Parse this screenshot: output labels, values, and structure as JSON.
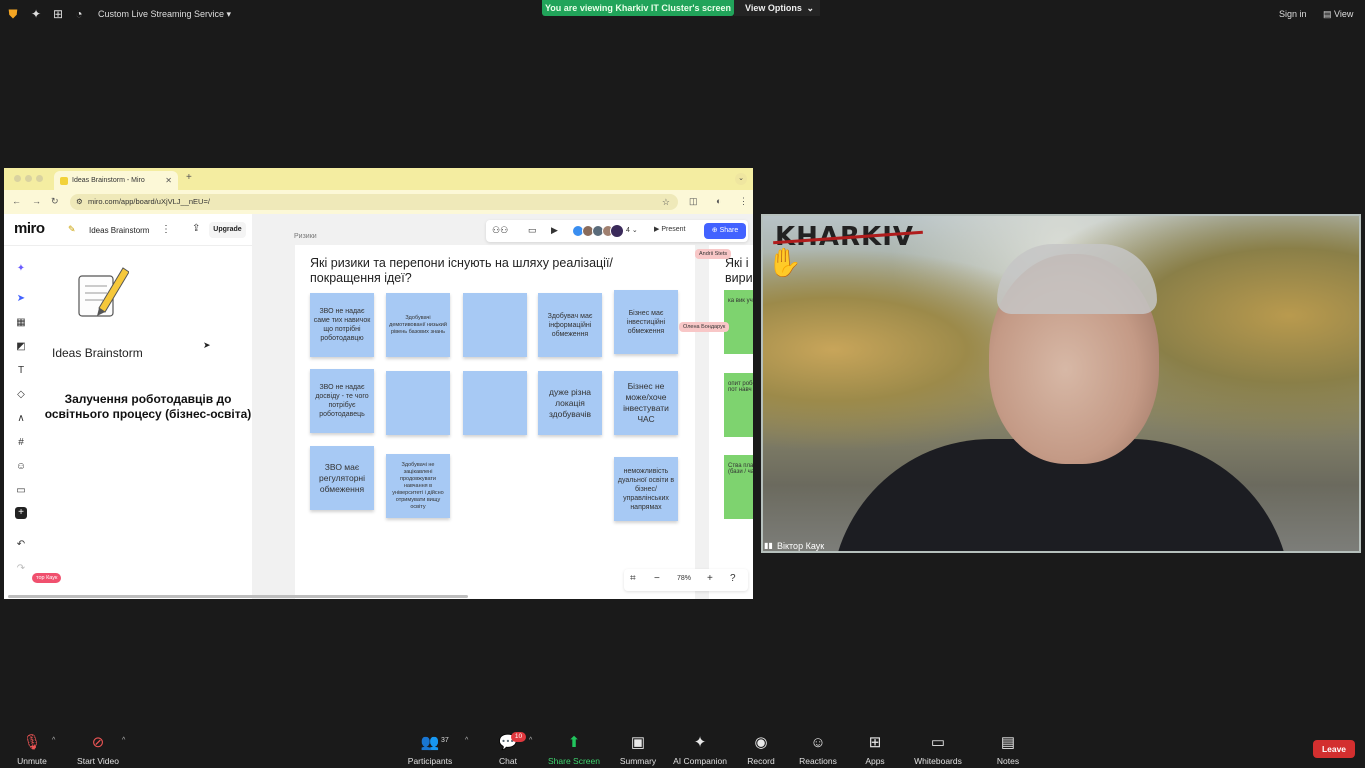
{
  "topbar": {
    "stream_label": "Custom Live Streaming Service ▾",
    "viewing_banner": "You are viewing Kharkiv IT Cluster's screen",
    "view_options": "View Options",
    "sign_in": "Sign in",
    "view": "View"
  },
  "browser": {
    "tab_title": "Ideas Brainstorm - Miro",
    "url": "miro.com/app/board/uXjVLJ__nEU=/"
  },
  "miro": {
    "logo": "miro",
    "board_name": "Ideas Brainstorm",
    "upgrade": "Upgrade",
    "present": "Present",
    "share": "Share",
    "avatar_count": "4",
    "zoom": "78%",
    "panel": {
      "ideas_title": "Ideas Brainstorm",
      "main_title": "Залучення роботодавців до освітнього процесу (бізнес-освіта)"
    },
    "cursor_tag": "тор Каук",
    "frame_label": "Ризики",
    "frame_title": "Які ризики та перепони існують на шляху реалізації/ покращення ідеї?",
    "frame2_title": "Які і вири",
    "collaborators": [
      "Andrii Stets",
      "Олена Бондарук"
    ],
    "stickies": [
      "ЗВО не надає саме тих навичок що потрібні роботодавцю",
      "Здобувачі демотивовані/ низький рівень базових знань",
      "",
      "Здобувач має інформаційні обмеження",
      "Бізнес має інвестиційні обмеження",
      "ЗВО не надає досвіду - те чого потрібує роботодавець",
      "",
      "",
      "дуже різна локація здобувачів",
      "Бізнес не може/хоче інвестувати ЧАС",
      "ЗВО має регуляторні обмеження",
      "Здобувачі не зацікавлені продовжувати навчання в університеті і дійсно отримувати вищу освіту",
      "неможливість дуальної освіти в бізнес/ управлінських напрямах"
    ],
    "green_stickies": [
      "ка вик учит",
      "опит робот т пот навч",
      "Ства плат (бази / ча"
    ]
  },
  "video": {
    "logo": "KHARKIV",
    "participant_name": "Віктор Каук"
  },
  "bottombar": {
    "unmute": "Unmute",
    "start_video": "Start Video",
    "participants": "Participants",
    "participant_count": "37",
    "chat": "Chat",
    "chat_badge": "10",
    "share_screen": "Share Screen",
    "summary": "Summary",
    "ai_companion": "AI Companion",
    "record": "Record",
    "reactions": "Reactions",
    "apps": "Apps",
    "whiteboards": "Whiteboards",
    "notes": "Notes",
    "leave": "Leave"
  },
  "colors": {
    "banner_green": "#21a45a",
    "share_blue": "#4262ff",
    "sticky_blue": "#a7c9f4",
    "sticky_green": "#7ed36f",
    "leave_red": "#d32f2f"
  }
}
